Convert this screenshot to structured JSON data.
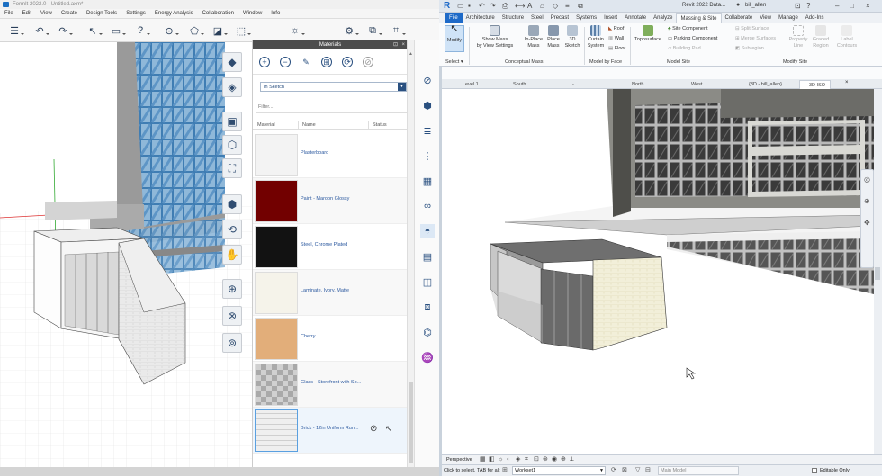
{
  "formit": {
    "title": "FormIt 2022.0 - Untitled.axm*",
    "menu": [
      "File",
      "Edit",
      "View",
      "Create",
      "Design Tools",
      "Settings",
      "Energy Analysis",
      "Collaboration",
      "Window",
      "Info"
    ],
    "toolbar_icons": [
      "layers-icon",
      "undo-icon",
      "redo-icon",
      "select-icon",
      "group-icon",
      "help-icon",
      "pin-icon",
      "shape-icon",
      "camera-icon",
      "cube-icon",
      "sun-icon",
      "gear-icon"
    ],
    "view_tools": [
      "view-cube-icon",
      "solid-icon",
      "box-icon",
      "cube-icon",
      "model-icon",
      "person-icon",
      "orbit-icon",
      "pan-icon",
      "zoom-in-icon",
      "zoom-window-icon",
      "zoom-extents-icon"
    ],
    "materials": {
      "panel_title": "Materials",
      "filter_select": "In Sketch",
      "filter_placeholder": "Filter...",
      "columns": {
        "material": "Material",
        "name": "Name",
        "status": "Status"
      },
      "items": [
        {
          "name": "Plasterboard",
          "color": "#f3f3f3"
        },
        {
          "name": "Paint - Maroon Glossy",
          "color": "#720000"
        },
        {
          "name": "Steel, Chrome Plated",
          "color": "#121212"
        },
        {
          "name": "Laminate, Ivory, Matte",
          "color": "#f5f3ea"
        },
        {
          "name": "Cherry",
          "color": "#e2ae7a"
        },
        {
          "name": "Glass - Storefront with Sp...",
          "color": "#bdbdbd"
        },
        {
          "name": "Brick - 12in Uniform Run...",
          "color": "#efefef"
        }
      ]
    },
    "right_panel_icons": [
      "navigate-icon",
      "cube-icon",
      "layers-icon",
      "properties-icon",
      "camera-icon",
      "glasses-icon",
      "materials-icon",
      "scenes-icon",
      "box-icon",
      "library-icon",
      "mesh-icon",
      "paint-icon"
    ]
  },
  "revit": {
    "doc_title": "Revit 2022 Data...",
    "user": "bill_allen",
    "tabs": [
      "File",
      "Architecture",
      "Structure",
      "Steel",
      "Precast",
      "Systems",
      "Insert",
      "Annotate",
      "Analyze",
      "Massing & Site",
      "Collaborate",
      "View",
      "Manage",
      "Add-Ins"
    ],
    "active_tab": "Massing & Site",
    "ribbon": {
      "modify": "Modify",
      "select_group": "Select",
      "show_mass": "Show Mass",
      "show_mass2": "by View Settings",
      "in_place": "In-Place",
      "in_place2": "Mass",
      "place": "Place",
      "place2": "Mass",
      "sketch3d": "3D",
      "sketch3d2": "Sketch",
      "curtain": "Curtain",
      "curtain2": "System",
      "roof": "Roof",
      "wall": "Wall",
      "floor": "Floor",
      "toposurface": "Toposurface",
      "site_component": "Site Component",
      "parking_component": "Parking Component",
      "building_pad": "Building Pad",
      "split_surface": "Split Surface",
      "merge_surfaces": "Merge Surfaces",
      "subregion": "Subregion",
      "property_line": "Property",
      "property_line2": "Line",
      "graded_region": "Graded",
      "graded_region2": "Region",
      "label_contours": "Label",
      "label_contours2": "Contours",
      "groups": {
        "select": "Select ▾",
        "conceptual": "Conceptual Mass",
        "model_by_face": "Model by Face",
        "model_site": "Model Site",
        "modify_site": "Modify Site"
      }
    },
    "view_tabs": [
      "Level 1",
      "South",
      "-",
      "North",
      "West",
      "{3D - bill_allen}",
      "3D ISO"
    ],
    "view_bar": {
      "mode": "Perspective"
    },
    "status": {
      "hint": "Click to select, TAB for alt",
      "workset": "Workset1",
      "model": "Main Model",
      "editable": "Editable Only"
    }
  }
}
